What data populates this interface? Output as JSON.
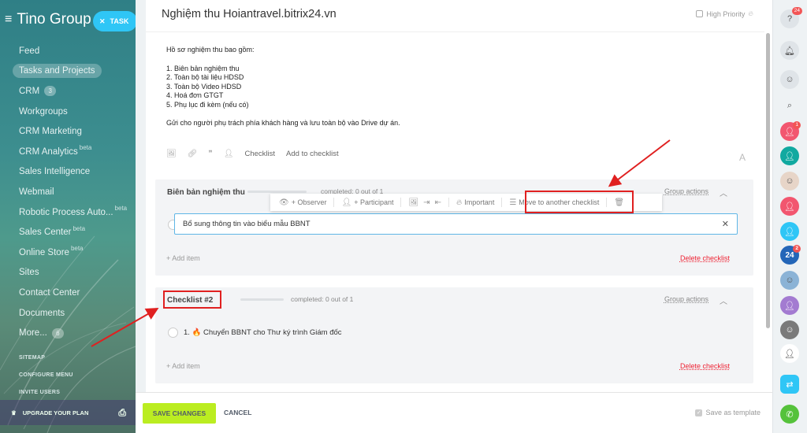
{
  "sidebar": {
    "brand": "Tino Group",
    "task_pill": "TASK",
    "items": [
      {
        "label": "Feed"
      },
      {
        "label": "Tasks and Projects",
        "active": true
      },
      {
        "label": "CRM",
        "count": "3"
      },
      {
        "label": "Workgroups"
      },
      {
        "label": "CRM Marketing"
      },
      {
        "label": "CRM Analytics",
        "sup": "beta"
      },
      {
        "label": "Sales Intelligence"
      },
      {
        "label": "Webmail"
      },
      {
        "label": "Robotic Process Auto...",
        "sup": "beta"
      },
      {
        "label": "Sales Center",
        "sup": "beta"
      },
      {
        "label": "Online Store",
        "sup": "beta"
      },
      {
        "label": "Sites"
      },
      {
        "label": "Contact Center"
      },
      {
        "label": "Documents"
      },
      {
        "label": "More...",
        "count": "6"
      }
    ],
    "sitemap": "SITEMAP",
    "configure_menu": "CONFIGURE MENU",
    "invite_users": "INVITE USERS",
    "upgrade": "UPGRADE YOUR PLAN"
  },
  "task": {
    "title": "Nghiệm thu Hoiantravel.bitrix24.vn",
    "high_priority": "High Priority",
    "description": {
      "intro": "Hồ sơ nghiệm thu bao gồm:",
      "lines": [
        "1. Biên bản nghiệm thu",
        "2. Toàn bộ tài liệu HDSD",
        "3. Toàn bộ Video HDSD",
        "4. Hoá đơn GTGT",
        "5. Phụ lục đi kèm (nếu có)"
      ],
      "outro": "Gửi cho người phụ trách phía khách hàng và lưu toàn bộ vào Drive dự án."
    },
    "toolbar": {
      "checklist": "Checklist",
      "add_to_checklist": "Add to checklist"
    }
  },
  "checklists": [
    {
      "title": "Biên bản nghiệm thu",
      "completed": "completed: 0 out of 1",
      "group_actions": "Group actions",
      "editing_item": "Bổ sung thông tin vào biểu mẫu BBNT",
      "add_item": "+ Add item",
      "delete": "Delete checklist"
    },
    {
      "title": "Checklist #2",
      "completed": "completed: 0 out of 1",
      "group_actions": "Group actions",
      "item": "1. 🔥 Chuyển BBNT cho Thư ký trình Giám đốc",
      "add_item": "+ Add item",
      "delete": "Delete checklist"
    }
  ],
  "action_bar": {
    "observer": "+ Observer",
    "participant": "+ Participant",
    "important": "Important",
    "move": "Move to another checklist"
  },
  "footer": {
    "save": "SAVE CHANGES",
    "cancel": "CANCEL",
    "save_template": "Save as template"
  },
  "rightbar": {
    "help_badge": "24",
    "badge1": "1",
    "badge2": "2",
    "b24": "24"
  },
  "colors": {
    "accent": "#2fc6f6",
    "save": "#bbed21",
    "annotation": "#e02020"
  }
}
